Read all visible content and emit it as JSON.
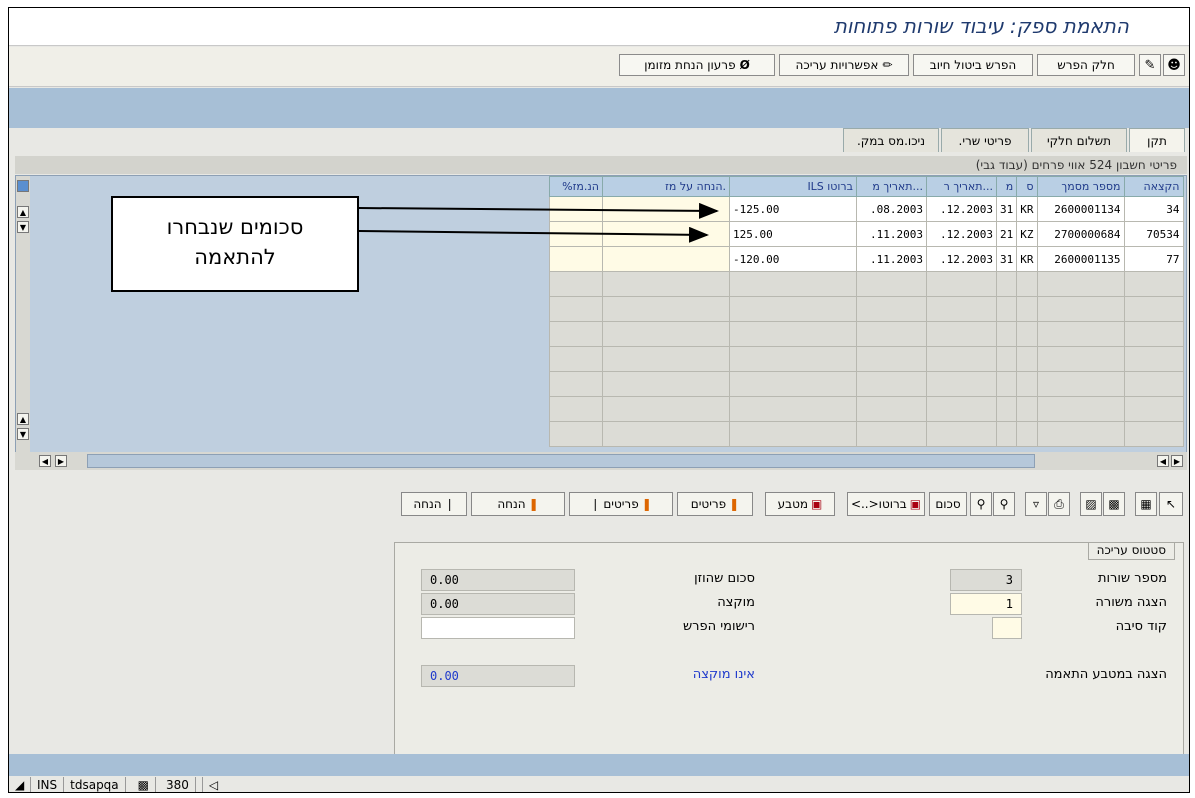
{
  "window": {
    "title": "התאמת ספק: עיבוד שורות פתוחות"
  },
  "toolbar": {
    "partial_diff": "חלק הפרש",
    "diff_cancel": "הפרש ביטול חיוב",
    "edit_options": "אפשרויות עריכה",
    "cash_discount": "פרעון הנחת מזומן"
  },
  "tabs": [
    {
      "label": "תקן"
    },
    {
      "label": "תשלום חלקי"
    },
    {
      "label": "פריטי שרי."
    },
    {
      "label": "ניכו.מס במק."
    }
  ],
  "account_header": "פריטי חשבון 524 אווי פרחים (עבוד גבי)",
  "table": {
    "columns": [
      "הקצאה",
      "מספר מסמך",
      "ס",
      "מ",
      "תאריך ר...",
      "תאריך מ...",
      "ILS ברוטו",
      "הנחה על מז.",
      "%הנ.מז"
    ],
    "rows": [
      {
        "assignment": "34",
        "doc_no": "2600001134",
        "doc_type": "KR",
        "m": "31",
        "date_r": ".12.2003",
        "date_m": ".08.2003",
        "gross": "-125.00",
        "disc": "",
        "disc_pct": ""
      },
      {
        "assignment": "70534",
        "doc_no": "2700000684",
        "doc_type": "KZ",
        "m": "21",
        "date_r": ".12.2003",
        "date_m": ".11.2003",
        "gross": "125.00",
        "disc": "",
        "disc_pct": ""
      },
      {
        "assignment": "77",
        "doc_no": "2600001135",
        "doc_type": "KR",
        "m": "31",
        "date_r": ".12.2003",
        "date_m": ".11.2003",
        "gross": "-120.00",
        "disc": "",
        "disc_pct": ""
      }
    ]
  },
  "callout": {
    "line1": "סכומים שנבחרו",
    "line2": "להתאמה"
  },
  "bottom_buttons": {
    "discount1": "הנחה",
    "discount2": "הנחה",
    "items1": "פריטים",
    "items2": "פריטים",
    "currency": "מטבע",
    "gross": "ברוטו<..>",
    "sum": "סכום"
  },
  "edit_status": {
    "tab": "סטטוס עריכה",
    "lines_label": "מספר שורות",
    "lines_value": "3",
    "display_from_label": "הצגה משורה",
    "display_from_value": "1",
    "reason_label": "קוד סיבה",
    "reason_value": "",
    "amount_entered_label": "סכום שהוזן",
    "amount_entered_value": "0.00",
    "assigned_label": "מוקצה",
    "assigned_value": "0.00",
    "diff_postings_label": "רישומי הפרש",
    "diff_postings_value": "",
    "display_currency_label": "הצגה במטבע התאמה",
    "not_assigned_label": "אינו מוקצה",
    "not_assigned_value": "0.00"
  },
  "statusbar": {
    "mode": "INS",
    "server": "tdsapqa",
    "client": "380"
  }
}
